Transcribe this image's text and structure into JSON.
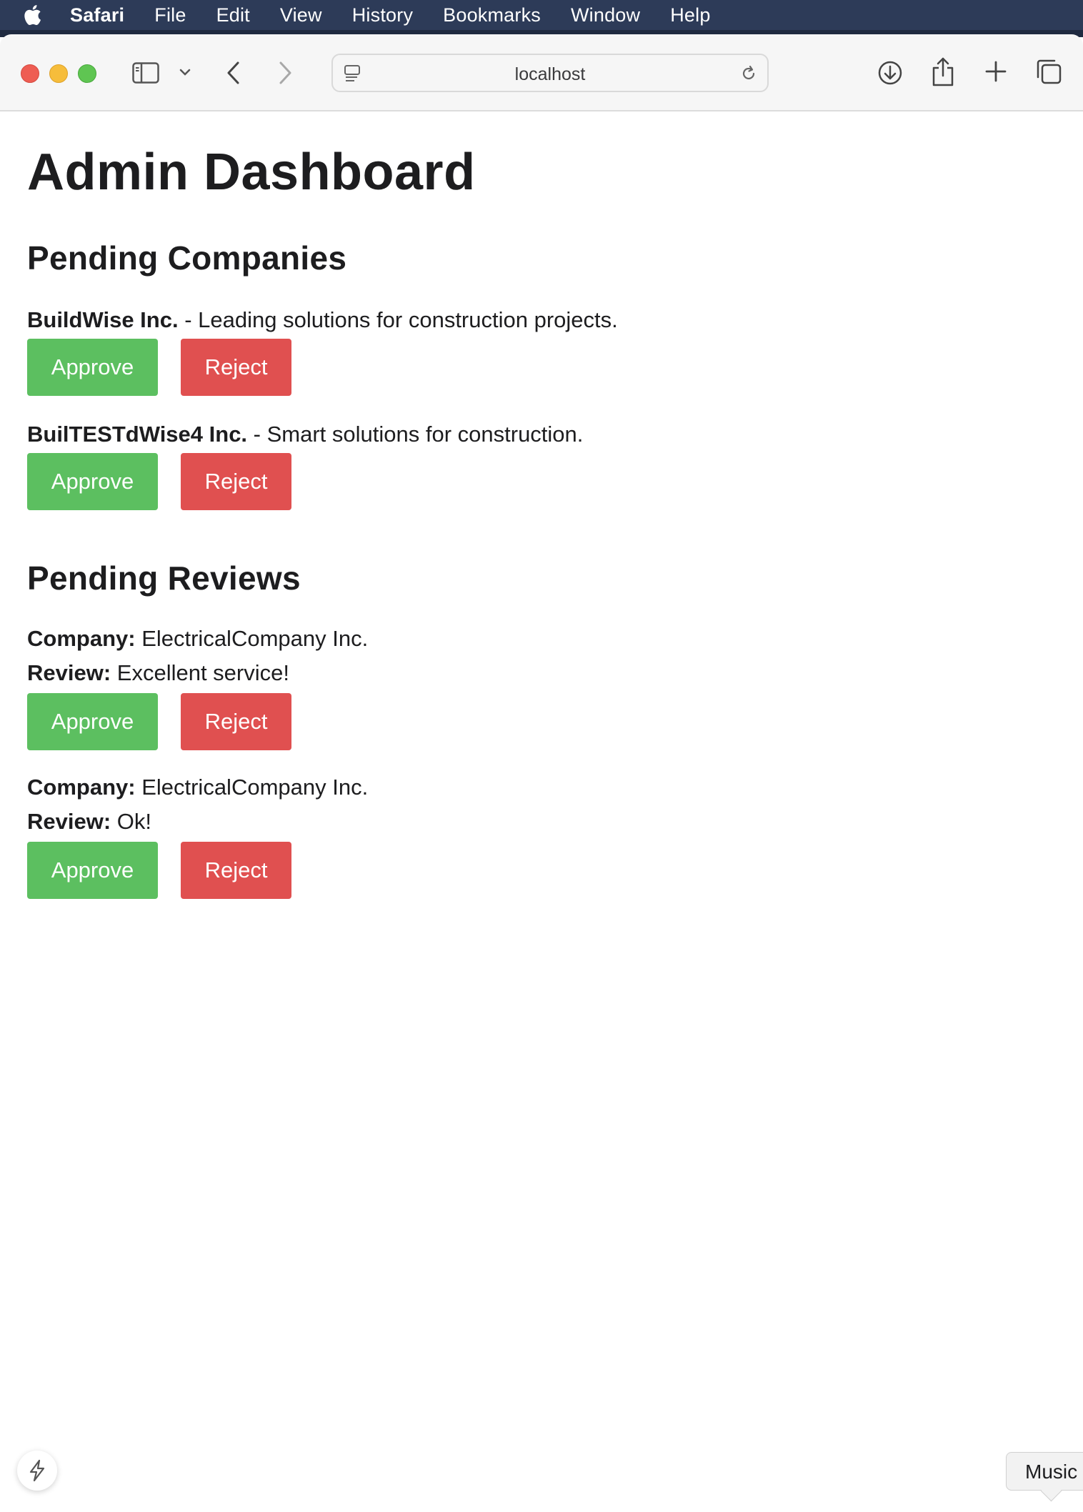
{
  "menubar": {
    "app": "Safari",
    "items": [
      "File",
      "Edit",
      "View",
      "History",
      "Bookmarks",
      "Window",
      "Help"
    ]
  },
  "toolbar": {
    "url": "localhost"
  },
  "page": {
    "title": "Admin Dashboard",
    "companies_heading": "Pending Companies",
    "companies": [
      {
        "name": "BuildWise Inc.",
        "description": " - Leading solutions for construction projects."
      },
      {
        "name": "BuilTESTdWise4 Inc.",
        "description": " - Smart solutions for construction."
      }
    ],
    "reviews_heading": "Pending Reviews",
    "company_label": "Company:",
    "review_label": "Review:",
    "reviews": [
      {
        "company": " ElectricalCompany Inc.",
        "review": " Excellent service!"
      },
      {
        "company": " ElectricalCompany Inc.",
        "review": " Ok!"
      }
    ],
    "approve_label": "Approve",
    "reject_label": "Reject"
  },
  "overlay": {
    "music_tooltip": "Music"
  },
  "colors": {
    "approve": "#5cbf60",
    "reject": "#e05050",
    "menubar": "#2d3b58"
  }
}
